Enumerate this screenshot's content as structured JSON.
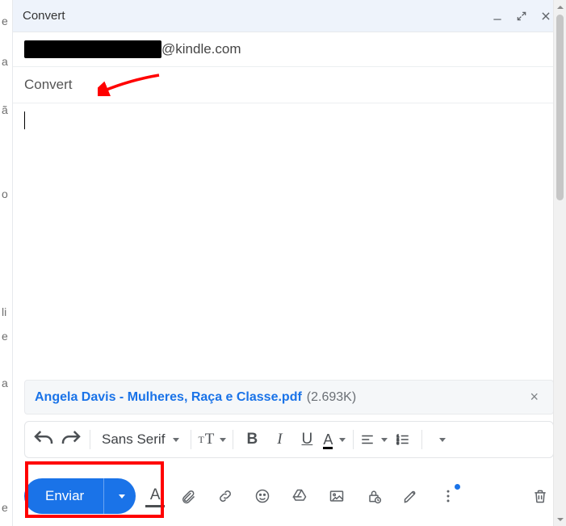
{
  "header": {
    "title": "Convert"
  },
  "to": {
    "redacted": true,
    "domain": "@kindle.com"
  },
  "subject": "Convert",
  "body_text": "",
  "attachment": {
    "filename": "Angela Davis - Mulheres, Raça e Classe.pdf",
    "size_label": "(2.693K)"
  },
  "format_toolbar": {
    "font_family": "Sans Serif",
    "size_glyph_small": "T",
    "size_glyph_big": "T",
    "bold": "B",
    "italic": "I",
    "underline": "U",
    "textcolor": "A"
  },
  "actions": {
    "send_label": "Enviar"
  },
  "bg_hints": [
    "e",
    "a",
    "ã",
    "o",
    "li",
    "e",
    "a",
    "e"
  ]
}
